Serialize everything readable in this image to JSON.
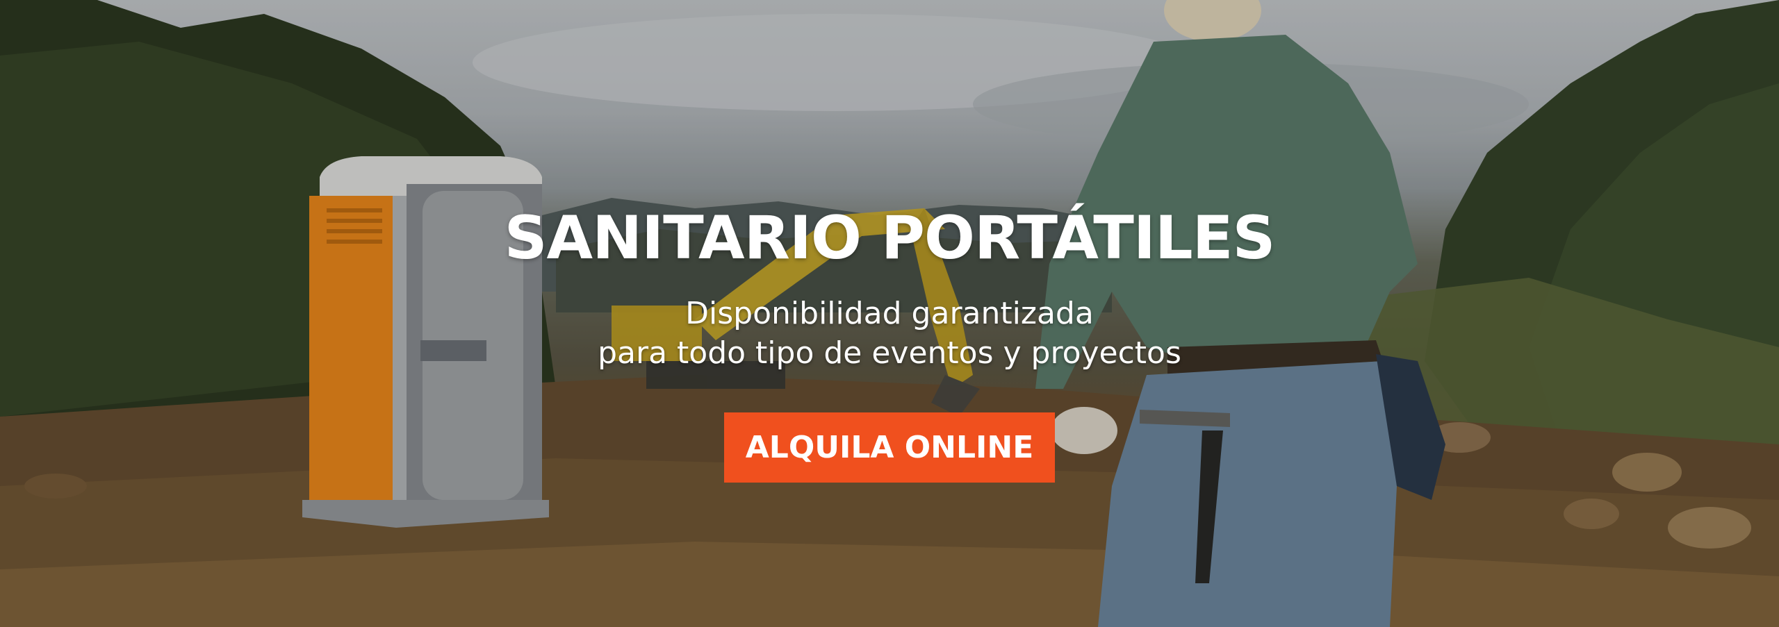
{
  "hero": {
    "title": "SANITARIO PORTÁTILES",
    "subtitle_line1": "Disponibilidad garantizada",
    "subtitle_line2": "para todo tipo de eventos y proyectos",
    "cta_label": "ALQUILA ONLINE"
  },
  "colors": {
    "cta_background": "#f0501e",
    "text": "#ffffff",
    "toilet_orange": "#f28c1c",
    "toilet_grey": "#8d9195"
  }
}
